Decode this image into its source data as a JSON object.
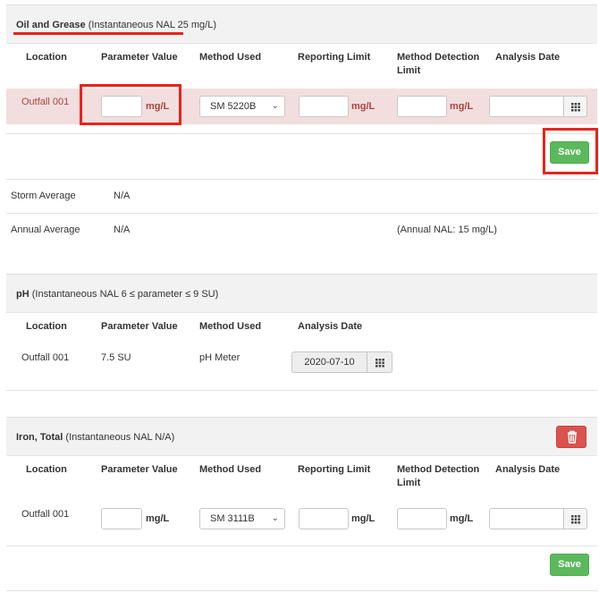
{
  "sections": {
    "oil": {
      "title": "Oil and Grease",
      "subtitle": "(Instantaneous NAL 25 mg/L)",
      "columns": [
        "Location",
        "Parameter Value",
        "Method Used",
        "Reporting Limit",
        "Method Detection Limit",
        "Analysis Date"
      ],
      "row": {
        "location": "Outfall 001",
        "param_unit": "mg/L",
        "method": "SM 5220B",
        "reporting_unit": "mg/L",
        "mdl_unit": "mg/L",
        "date_value": ""
      },
      "save_label": "Save",
      "storm_label": "Storm Average",
      "storm_value": "N/A",
      "annual_label": "Annual Average",
      "annual_value": "N/A",
      "annual_note": "(Annual NAL: 15 mg/L)"
    },
    "ph": {
      "title": "pH",
      "subtitle": "(Instantaneous NAL 6 ≤ parameter ≤ 9 SU)",
      "columns": [
        "Location",
        "Parameter Value",
        "Method Used",
        "Analysis Date"
      ],
      "row": {
        "location": "Outfall 001",
        "value": "7.5 SU",
        "method": "pH Meter",
        "date_value": "2020-07-10"
      }
    },
    "iron": {
      "title": "Iron, Total",
      "subtitle": "(Instantaneous NAL N/A)",
      "columns": [
        "Location",
        "Parameter Value",
        "Method Used",
        "Reporting Limit",
        "Method Detection Limit",
        "Analysis Date"
      ],
      "row": {
        "location": "Outfall 001",
        "param_unit": "mg/L",
        "method": "SM 3111B",
        "reporting_unit": "mg/L",
        "mdl_unit": "mg/L",
        "date_value": ""
      },
      "save_label": "Save"
    }
  },
  "colors": {
    "highlight_row": "#f2dede",
    "error_text": "#a94442",
    "save_green": "#5cb85c",
    "delete_red": "#d9534f",
    "annotation_red": "#e8241c"
  }
}
